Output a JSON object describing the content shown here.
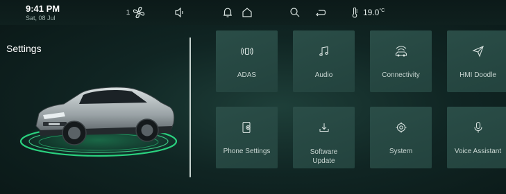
{
  "status_bar": {
    "time": "9:41 PM",
    "date": "Sat, 08 Jul",
    "fan_level": "1",
    "temperature": "19.0",
    "temperature_unit": "°C",
    "icons": [
      "fan-icon",
      "speaker-icon",
      "bell-icon",
      "home-icon",
      "search-icon",
      "return-icon",
      "thermometer-icon"
    ]
  },
  "page": {
    "title": "Settings"
  },
  "tiles": [
    {
      "label": "ADAS",
      "icon": "adas-icon"
    },
    {
      "label": "Audio",
      "icon": "music-note-icon"
    },
    {
      "label": "Connectivity",
      "icon": "connected-car-icon"
    },
    {
      "label": "HMI Doodle",
      "icon": "paper-plane-icon"
    },
    {
      "label": "Phone Settings",
      "icon": "phone-gear-icon"
    },
    {
      "label": "Software Update",
      "icon": "download-icon"
    },
    {
      "label": "System",
      "icon": "system-gear-icon"
    },
    {
      "label": "Voice Assistant",
      "icon": "microphone-icon"
    }
  ],
  "colors": {
    "background": "#102523",
    "tile": "#284a44",
    "accent_glow": "#2ee58a"
  }
}
